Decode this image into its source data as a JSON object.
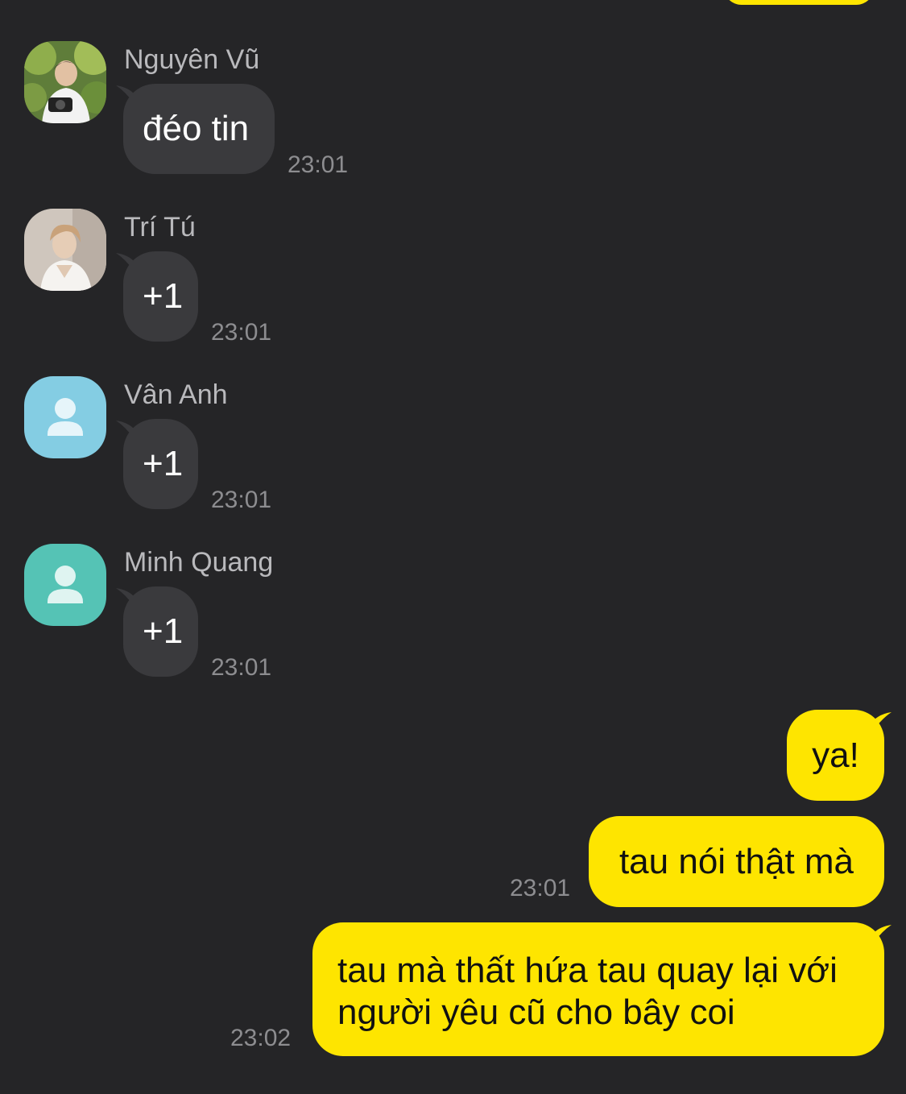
{
  "colors": {
    "background": "#252527",
    "incoming_bubble": "#3a3a3d",
    "outgoing_bubble": "#fee500",
    "sender_name": "#b9b9bc",
    "timestamp": "#8d8d90",
    "avatar_blue": "#84cde3",
    "avatar_teal": "#55c3b5"
  },
  "incoming": [
    {
      "sender": "Nguyên Vũ",
      "avatar": "photo-avatar",
      "text": "đéo tin",
      "time": "23:01"
    },
    {
      "sender": "Trí Tú",
      "avatar": "photo-avatar",
      "text": "+1",
      "time": "23:01"
    },
    {
      "sender": "Vân Anh",
      "avatar": "default-person-icon",
      "text": "+1",
      "time": "23:01"
    },
    {
      "sender": "Minh Quang",
      "avatar": "default-person-icon",
      "text": "+1",
      "time": "23:01"
    }
  ],
  "outgoing": [
    {
      "text": "ya!",
      "time": ""
    },
    {
      "text": "tau nói thật mà",
      "time": "23:01"
    },
    {
      "lines": [
        "tau mà thất hứa tau quay lại với",
        "người yêu cũ cho bây coi"
      ],
      "time": "23:02"
    }
  ]
}
